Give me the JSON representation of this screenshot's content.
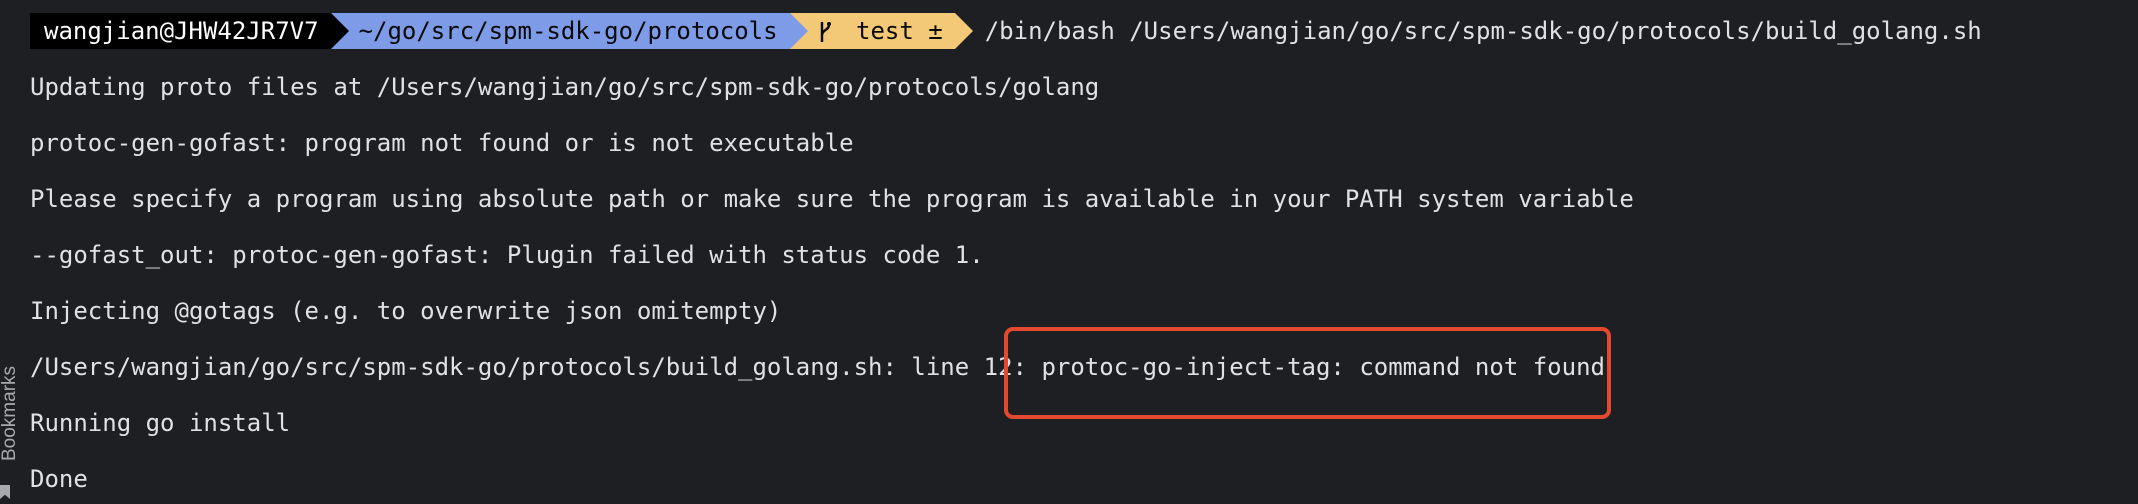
{
  "sidebar": {
    "bookmarks_label": "Bookmarks"
  },
  "prompt": {
    "user_host": "wangjian@JHW42JR7V7",
    "path": "~/go/src/spm-sdk-go/protocols",
    "git": "test ±",
    "command": "/bin/bash /Users/wangjian/go/src/spm-sdk-go/protocols/build_golang.sh"
  },
  "output": [
    "Updating proto files at /Users/wangjian/go/src/spm-sdk-go/protocols/golang",
    "protoc-gen-gofast: program not found or is not executable",
    "Please specify a program using absolute path or make sure the program is available in your PATH system variable",
    "--gofast_out: protoc-gen-gofast: Plugin failed with status code 1.",
    "Injecting @gotags (e.g. to overwrite json omitempty)",
    "/Users/wangjian/go/src/spm-sdk-go/protocols/build_golang.sh: line 12: protoc-go-inject-tag: command not found",
    "Running go install",
    "Done"
  ],
  "colors": {
    "background": "#1e1f22",
    "text": "#dfe1e5",
    "user_segment": "#000000",
    "path_segment": "#7e9be8",
    "git_segment": "#f3c877",
    "highlight_border": "#e3492f"
  }
}
